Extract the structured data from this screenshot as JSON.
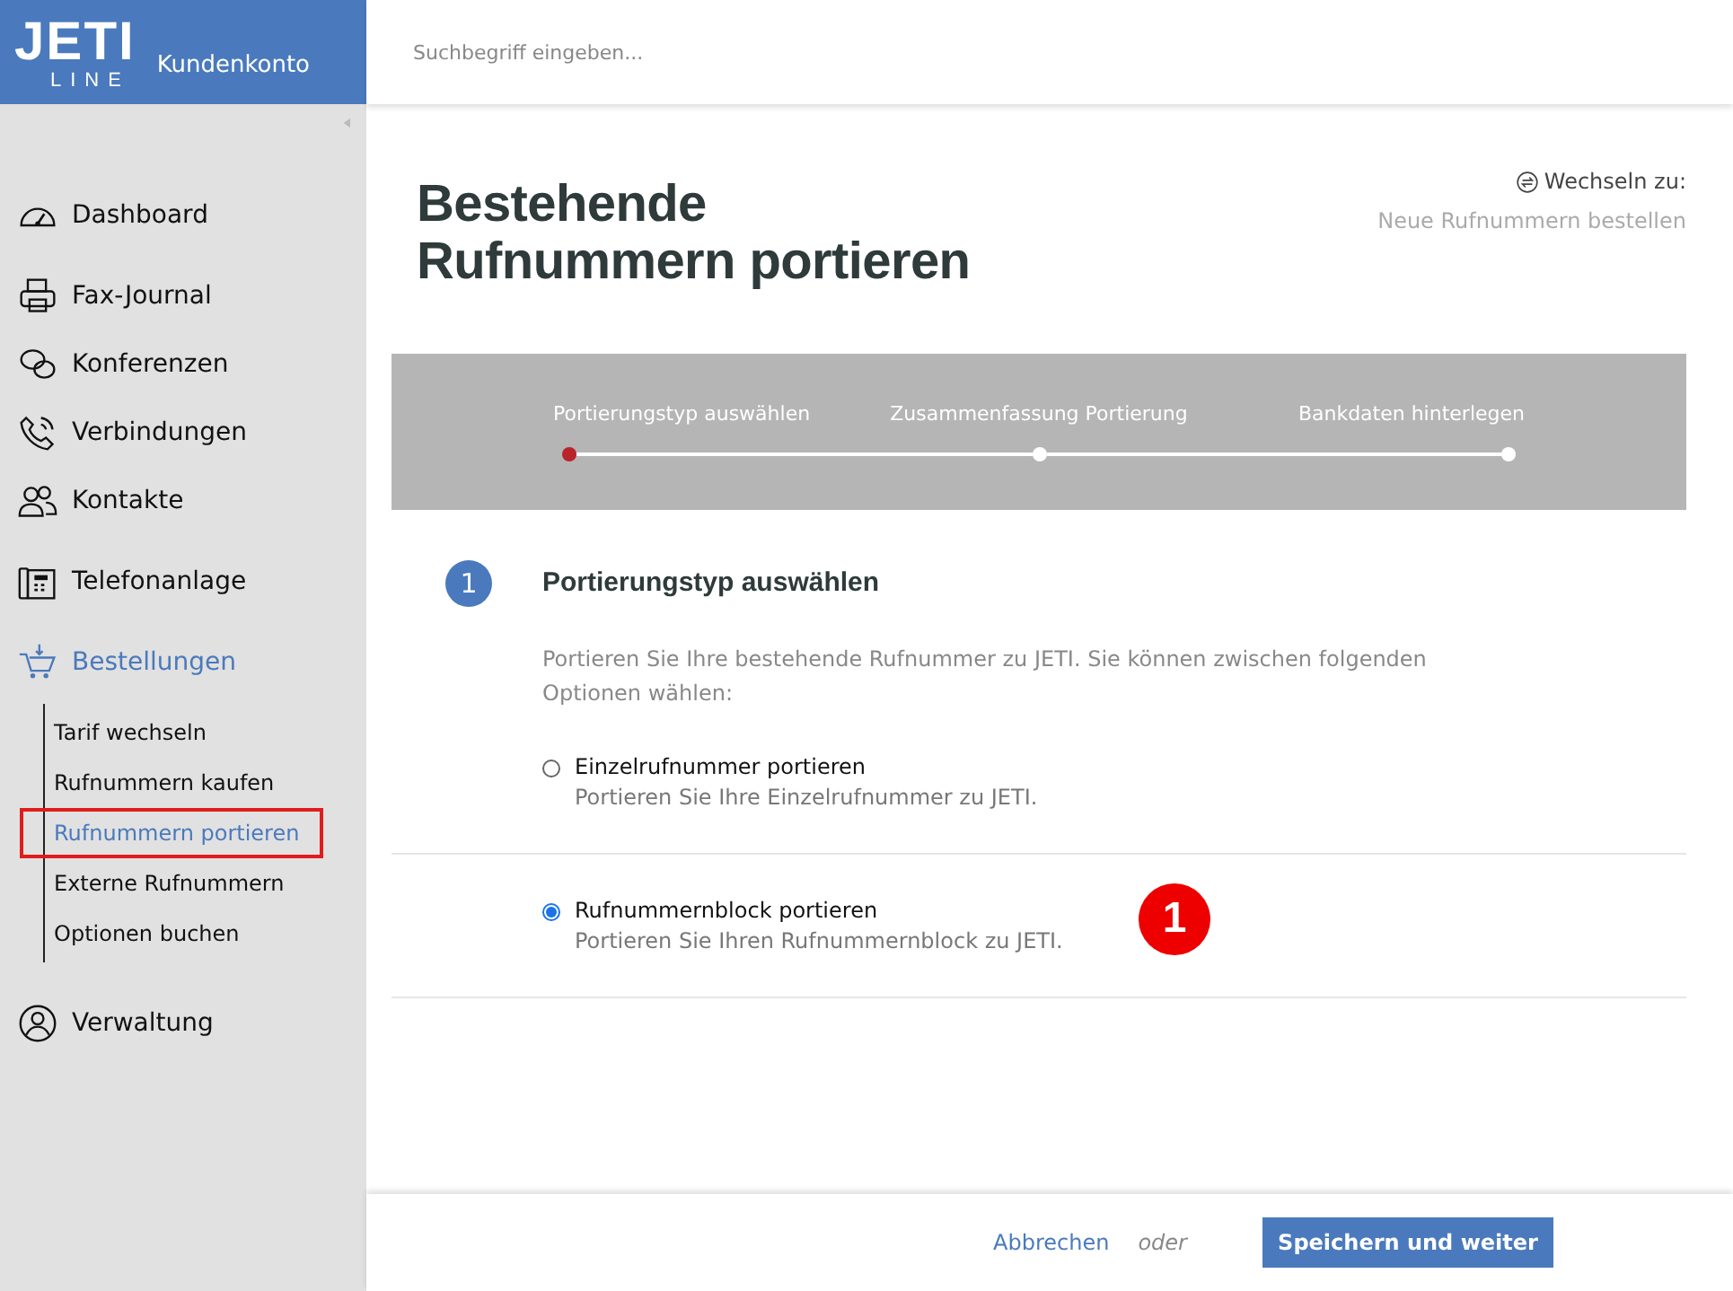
{
  "logo": {
    "wordmark": "JETI",
    "subline": "LINE",
    "product": "Kundenkonto"
  },
  "search": {
    "placeholder": "Suchbegriff eingeben..."
  },
  "sidebar": {
    "sections": [
      {
        "items": [
          {
            "label": "Dashboard",
            "selected": false
          }
        ]
      },
      {
        "items": [
          {
            "label": "Fax-Journal",
            "selected": false
          },
          {
            "label": "Konferenzen",
            "selected": false
          },
          {
            "label": "Verbindungen",
            "selected": false
          },
          {
            "label": "Kontakte",
            "selected": false
          }
        ]
      },
      {
        "items": [
          {
            "label": "Telefonanlage",
            "selected": false
          }
        ]
      },
      {
        "items": [
          {
            "label": "Bestellungen",
            "selected": true,
            "children": [
              {
                "label": "Tarif wechseln",
                "selected": false,
                "highlighted": false
              },
              {
                "label": "Rufnummern kaufen",
                "selected": false,
                "highlighted": false
              },
              {
                "label": "Rufnummern portieren",
                "selected": true,
                "highlighted": true
              },
              {
                "label": "Externe Rufnummern",
                "selected": false,
                "highlighted": false
              },
              {
                "label": "Optionen buchen",
                "selected": false,
                "highlighted": false
              }
            ]
          }
        ]
      },
      {
        "items": [
          {
            "label": "Verwaltung",
            "selected": false
          }
        ]
      }
    ]
  },
  "page": {
    "title": "Bestehende Rufnummern portieren",
    "switch_label": "Wechseln zu:",
    "switch_link": "Neue Rufnummern bestellen"
  },
  "steps": [
    {
      "label": "Portierungstyp auswählen",
      "current": true
    },
    {
      "label": "Zusammenfassung Portierung",
      "current": false
    },
    {
      "label": "Bankdaten hinterlegen",
      "current": false
    }
  ],
  "section": {
    "number": "1",
    "heading": "Portierungstyp auswählen",
    "intro": "Portieren Sie Ihre bestehende Rufnummer zu JETI. Sie können zwischen folgenden Optionen wählen:",
    "options": [
      {
        "label": "Einzelrufnummer portieren",
        "description": "Portieren Sie Ihre Einzelrufnummer zu JETI.",
        "selected": false
      },
      {
        "label": "Rufnummernblock portieren",
        "description": "Portieren Sie Ihren Rufnummernblock zu JETI.",
        "selected": true
      }
    ]
  },
  "annotation_badge": {
    "text": "1"
  },
  "footer": {
    "cancel": "Abbrechen",
    "separator": "oder",
    "submit": "Speichern und weiter"
  }
}
